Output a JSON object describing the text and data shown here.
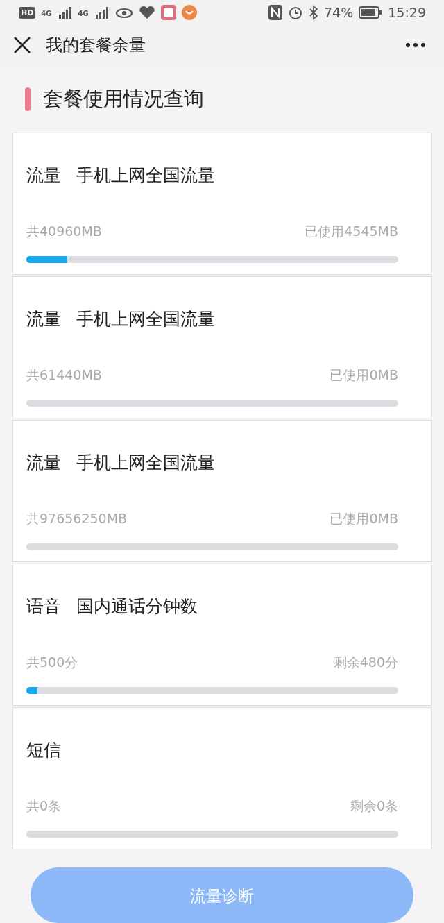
{
  "status_bar": {
    "left": [
      "HD",
      "4G",
      "4G"
    ],
    "battery": "74%",
    "time": "15:29"
  },
  "header": {
    "title": "我的套餐余量"
  },
  "section": {
    "title": "套餐使用情况查询"
  },
  "cards": [
    {
      "type": "流量",
      "name": "手机上网全国流量",
      "total": "共40960MB",
      "usage": "已使用4545MB",
      "level": 0.11
    },
    {
      "type": "流量",
      "name": "手机上网全国流量",
      "total": "共61440MB",
      "usage": "已使用0MB"
    },
    {
      "type": "流量",
      "name": "手机上网全国流量",
      "total": "共97656250MB",
      "usage": "已使用0MB"
    },
    {
      "type": "语音",
      "name": "国内通话分钟数",
      "total": "共500分",
      "usage": "剩余480分",
      "level": 0.03
    },
    {
      "type": "短信",
      "total": "共0条",
      "usage": "剩余0条"
    }
  ],
  "button": {
    "label": "流量诊断"
  }
}
